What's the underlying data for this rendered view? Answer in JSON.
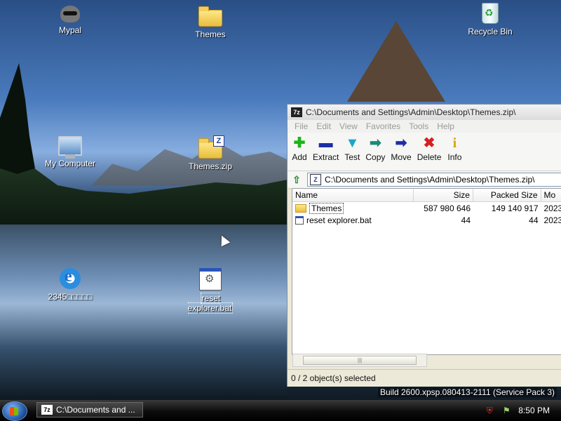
{
  "desktop": {
    "icons": [
      {
        "label": "Mypal",
        "icon": "raccoon-icon"
      },
      {
        "label": "Themes",
        "icon": "folder-icon"
      },
      {
        "label": "Recycle Bin",
        "icon": "recycle-bin-icon"
      },
      {
        "label": "My Computer",
        "icon": "computer-icon"
      },
      {
        "label": "Themes.zip",
        "icon": "zip-archive-icon"
      },
      {
        "label": "2345□□□□□",
        "icon": "internet-explorer-icon"
      },
      {
        "label": "reset explorer.bat",
        "icon": "batch-file-icon"
      }
    ]
  },
  "window": {
    "title": "C:\\Documents and Settings\\Admin\\Desktop\\Themes.zip\\",
    "app_icon": "7z",
    "menu": [
      "File",
      "Edit",
      "View",
      "Favorites",
      "Tools",
      "Help"
    ],
    "toolbar": [
      {
        "label": "Add",
        "icon": "plus-icon",
        "color": "#19b519"
      },
      {
        "label": "Extract",
        "icon": "minus-icon",
        "color": "#1c2fa6"
      },
      {
        "label": "Test",
        "icon": "check-icon",
        "color": "#1aa6c9"
      },
      {
        "label": "Copy",
        "icon": "copy-arrow-icon",
        "color": "#1a8a7a"
      },
      {
        "label": "Move",
        "icon": "move-arrow-icon",
        "color": "#1c2fa6"
      },
      {
        "label": "Delete",
        "icon": "x-icon",
        "color": "#d81e1e"
      },
      {
        "label": "Info",
        "icon": "info-icon",
        "color": "#d9a800"
      }
    ],
    "address": "C:\\Documents and Settings\\Admin\\Desktop\\Themes.zip\\",
    "columns": [
      "Name",
      "Size",
      "Packed Size",
      "Mo"
    ],
    "rows": [
      {
        "name": "Themes",
        "type": "folder",
        "size": "587 980 646",
        "packed": "149 140 917",
        "modified": "2023"
      },
      {
        "name": "reset explorer.bat",
        "type": "bat",
        "size": "44",
        "packed": "44",
        "modified": "2023"
      }
    ],
    "status": "0 / 2 object(s) selected"
  },
  "build_text": "Build 2600.xpsp.080413-2111 (Service Pack 3)",
  "taskbar": {
    "task_label": "C:\\Documents and ...",
    "time": "8:50 PM"
  }
}
